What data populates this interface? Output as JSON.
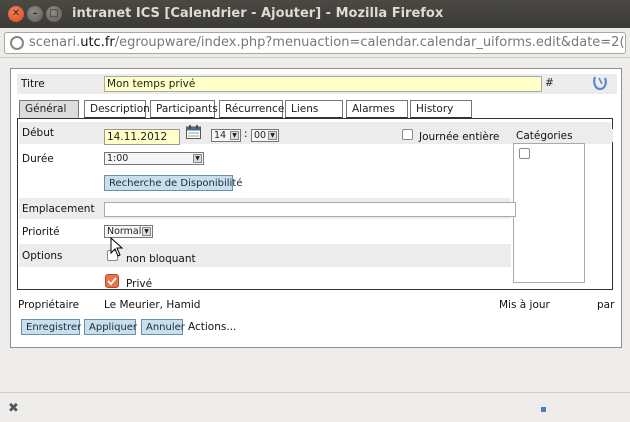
{
  "window": {
    "title": "intranet ICS [Calendrier - Ajouter] - Mozilla Firefox",
    "close_glyph": "✕",
    "min_glyph": "–",
    "max_glyph": "□"
  },
  "url": {
    "prefix": "scenari.",
    "domain": "utc.fr",
    "path": "/egroupware/index.php?menuaction=calendar.calendar_uiforms.edit&date=2("
  },
  "form": {
    "title_label": "Titre",
    "title_value": "Mon temps privé",
    "title_hash": "#",
    "tabs": [
      "Général",
      "Description",
      "Participants",
      "Récurrence",
      "Liens",
      "Alarmes",
      "History"
    ],
    "start_label": "Début",
    "start_date": "14.11.2012",
    "start_hour": "14",
    "time_sep": ":",
    "start_min": "00",
    "allday_label": "Journée entière",
    "categories_label": "Catégories",
    "duration_label": "Durée",
    "duration_value": "1:00",
    "availability_button": "Recherche de Disponibilité",
    "location_label": "Emplacement",
    "priority_label": "Priorité",
    "priority_value": "Normal",
    "options_label": "Options",
    "nonblocking_label": "non bloquant",
    "private_label": "Privé",
    "private_checked": true,
    "owner_label": "Propriétaire",
    "owner_value": "Le Meurier, Hamid",
    "updated_label": "Mis à jour",
    "by_label": "par"
  },
  "actions": {
    "save": "Enregistrer",
    "apply": "Appliquer",
    "cancel": "Annuler",
    "more": "Actions..."
  },
  "statusbar": {
    "close_glyph": "✖"
  },
  "colors": {
    "highlight_input": "#ffffc8",
    "button_blue": "#c9dfee",
    "private_checkbox": "#e9734a"
  }
}
